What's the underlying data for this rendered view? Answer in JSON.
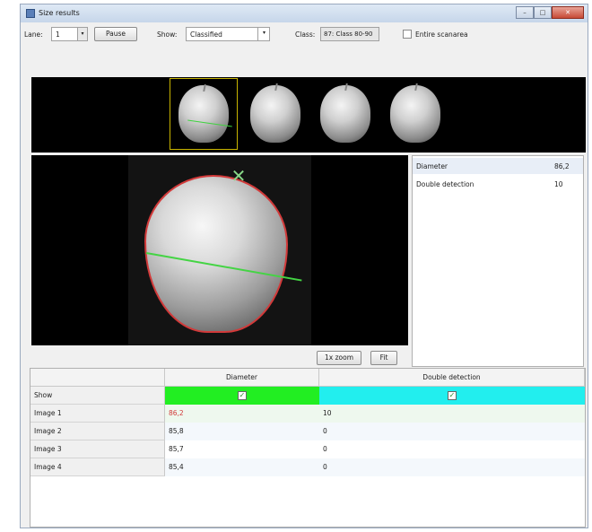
{
  "window": {
    "title": "Size results"
  },
  "toolbar": {
    "lane_label": "Lane:",
    "lane_value": "1",
    "pause_label": "Pause",
    "show_label": "Show:",
    "show_value": "Classified",
    "class_label": "Class:",
    "class_value": "87: Class 80-90",
    "entire_scan_label": "Entire scanarea"
  },
  "view_buttons": {
    "zoom_label": "1x zoom",
    "fit_label": "Fit"
  },
  "info": {
    "rows": [
      {
        "key": "Diameter",
        "value": "86,2"
      },
      {
        "key": "Double detection",
        "value": "10"
      }
    ]
  },
  "table": {
    "columns": [
      "Diameter",
      "Double detection"
    ],
    "show_label": "Show",
    "rows": [
      {
        "label": "Image 1",
        "diameter": "86,2",
        "double": "10"
      },
      {
        "label": "Image 2",
        "diameter": "85,8",
        "double": "0"
      },
      {
        "label": "Image 3",
        "diameter": "85,7",
        "double": "0"
      },
      {
        "label": "Image 4",
        "diameter": "85,4",
        "double": "0"
      }
    ]
  },
  "colors": {
    "diameter_show": "#22ee22",
    "double_show": "#22eeee",
    "highlight_value": "#d23a3a",
    "selection_border": "#c8b400"
  },
  "icons": {
    "check": "✓",
    "dropdown": "▾"
  }
}
